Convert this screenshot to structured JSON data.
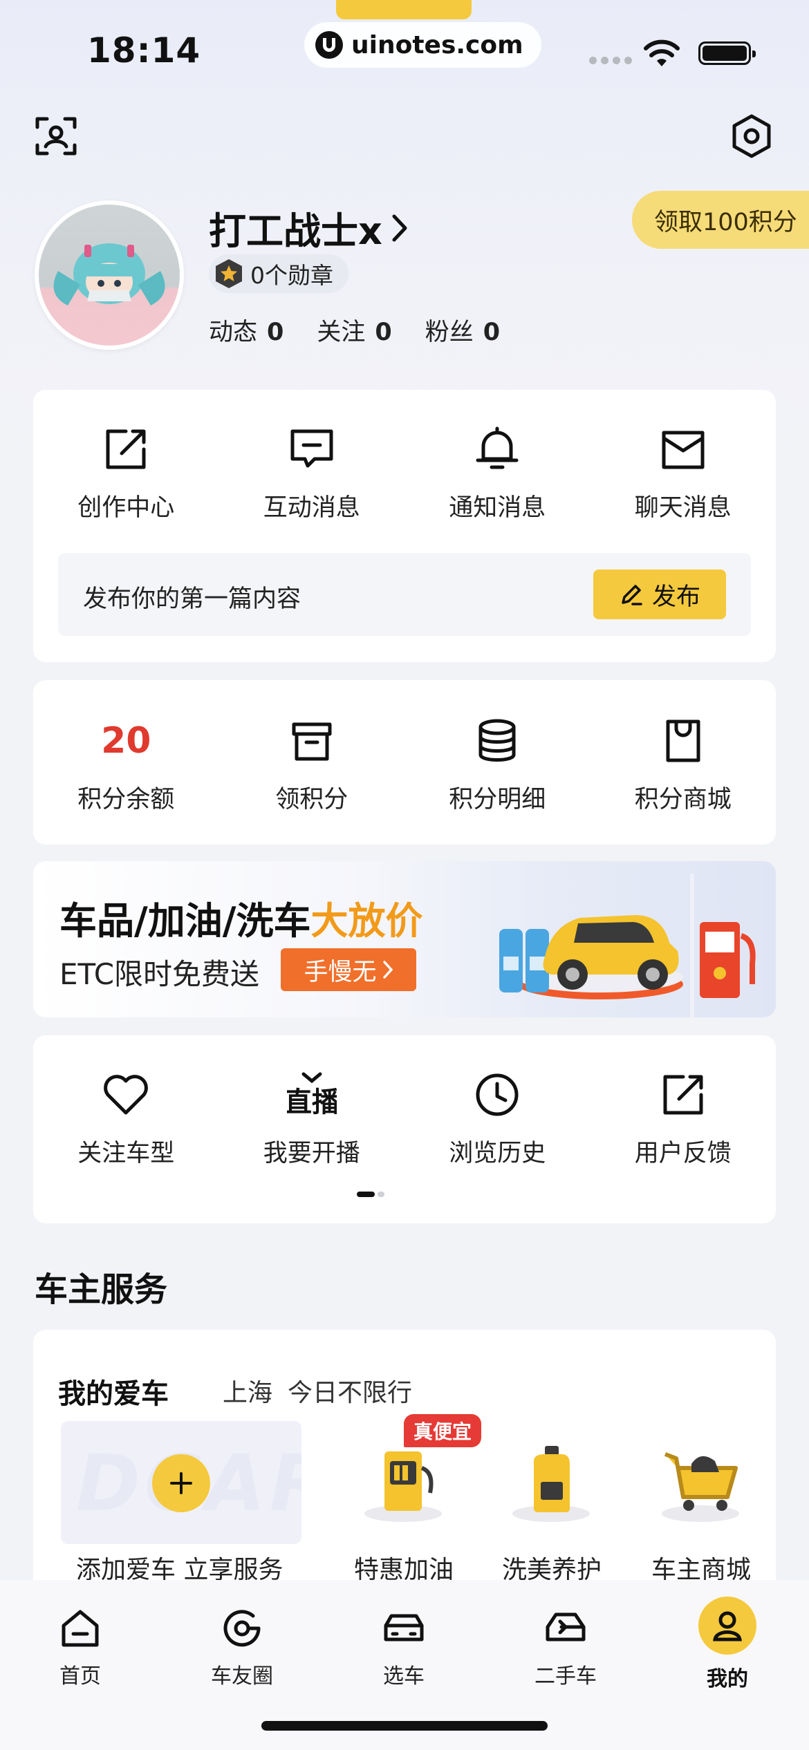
{
  "status_bar": {
    "time": "18:14",
    "watermark": "uinotes.com"
  },
  "profile": {
    "username": "打工战士x",
    "medals": "0个勋章",
    "stats": [
      {
        "label": "动态",
        "value": "0"
      },
      {
        "label": "关注",
        "value": "0"
      },
      {
        "label": "粉丝",
        "value": "0"
      }
    ],
    "points_claim": "领取100积分"
  },
  "messages": {
    "items": [
      {
        "label": "创作中心",
        "icon": "edit-square-icon"
      },
      {
        "label": "互动消息",
        "icon": "chat-bubble-icon"
      },
      {
        "label": "通知消息",
        "icon": "bell-icon"
      },
      {
        "label": "聊天消息",
        "icon": "envelope-icon"
      }
    ],
    "publish_prompt": "发布你的第一篇内容",
    "publish_button": "发布"
  },
  "points": {
    "balance": "20",
    "items": [
      {
        "label": "积分余额"
      },
      {
        "label": "领积分",
        "icon": "gift-box-icon"
      },
      {
        "label": "积分明细",
        "icon": "database-icon"
      },
      {
        "label": "积分商城",
        "icon": "shopping-bag-icon"
      }
    ]
  },
  "banner": {
    "title": "车品/加油/洗车",
    "title_highlight": "大放价",
    "subtitle": "ETC限时免费送",
    "button": "手慢无"
  },
  "tools": {
    "items": [
      {
        "label": "关注车型",
        "icon": "heart-icon"
      },
      {
        "label": "我要开播",
        "icon": "live-tv-icon"
      },
      {
        "label": "浏览历史",
        "icon": "clock-icon"
      },
      {
        "label": "用户反馈",
        "icon": "feedback-edit-icon"
      }
    ]
  },
  "owner_services": {
    "section_title": "车主服务",
    "my_car_title": "我的爱车",
    "city": "上海",
    "restriction": "今日不限行",
    "add_car_label": "添加爱车 立享服务",
    "deal_tag": "真便宜",
    "services": [
      {
        "label": "特惠加油",
        "icon": "fuel-pump-icon"
      },
      {
        "label": "洗美养护",
        "icon": "oil-bottle-icon"
      },
      {
        "label": "车主商城",
        "icon": "shopping-cart-icon"
      }
    ]
  },
  "tabbar": {
    "tabs": [
      {
        "label": "首页",
        "icon": "home-icon"
      },
      {
        "label": "车友圈",
        "icon": "circle-community-icon"
      },
      {
        "label": "选车",
        "icon": "car-icon"
      },
      {
        "label": "二手车",
        "icon": "used-car-icon"
      },
      {
        "label": "我的",
        "icon": "profile-icon",
        "active": true
      }
    ]
  },
  "colors": {
    "accent": "#f5c93d",
    "points_value": "#e03a2f",
    "banner_highlight": "#f29a1a",
    "banner_button": "#f06f2a",
    "deal_tag": "#e53a35"
  }
}
